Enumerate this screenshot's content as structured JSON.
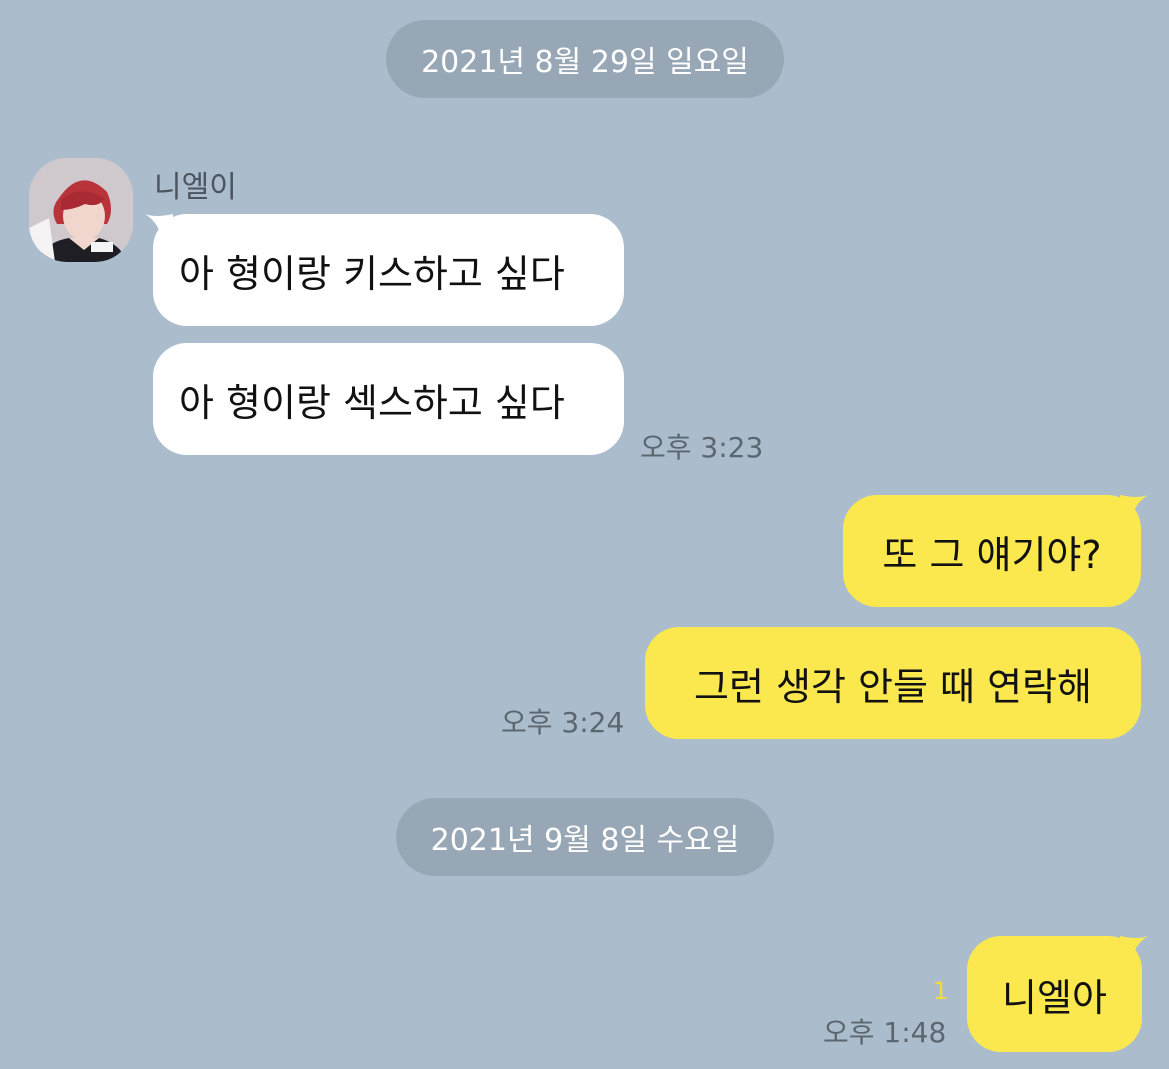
{
  "dates": {
    "first": "2021년 8월 29일 일요일",
    "second": "2021년 9월 8일 수요일"
  },
  "contact": {
    "name": "니엘이",
    "avatar_icon": "profile-photo-icon"
  },
  "messages": [
    {
      "side": "incoming",
      "text": "아 형이랑 키스하고 싶다"
    },
    {
      "side": "incoming",
      "text": "아 형이랑 섹스하고 싶다",
      "time": "오후 3:23"
    },
    {
      "side": "outgoing",
      "text": "또 그 얘기야?"
    },
    {
      "side": "outgoing",
      "text": "그런 생각 안들 때 연락해",
      "time": "오후 3:24"
    },
    {
      "side": "outgoing",
      "text": "니엘아",
      "time": "오후 1:48",
      "unread": "1"
    }
  ],
  "colors": {
    "background": "#abbdcc",
    "date_pill": "#98a7b5",
    "incoming_bubble": "#ffffff",
    "outgoing_bubble": "#fbe84e",
    "unread_count": "#f3d93a"
  }
}
